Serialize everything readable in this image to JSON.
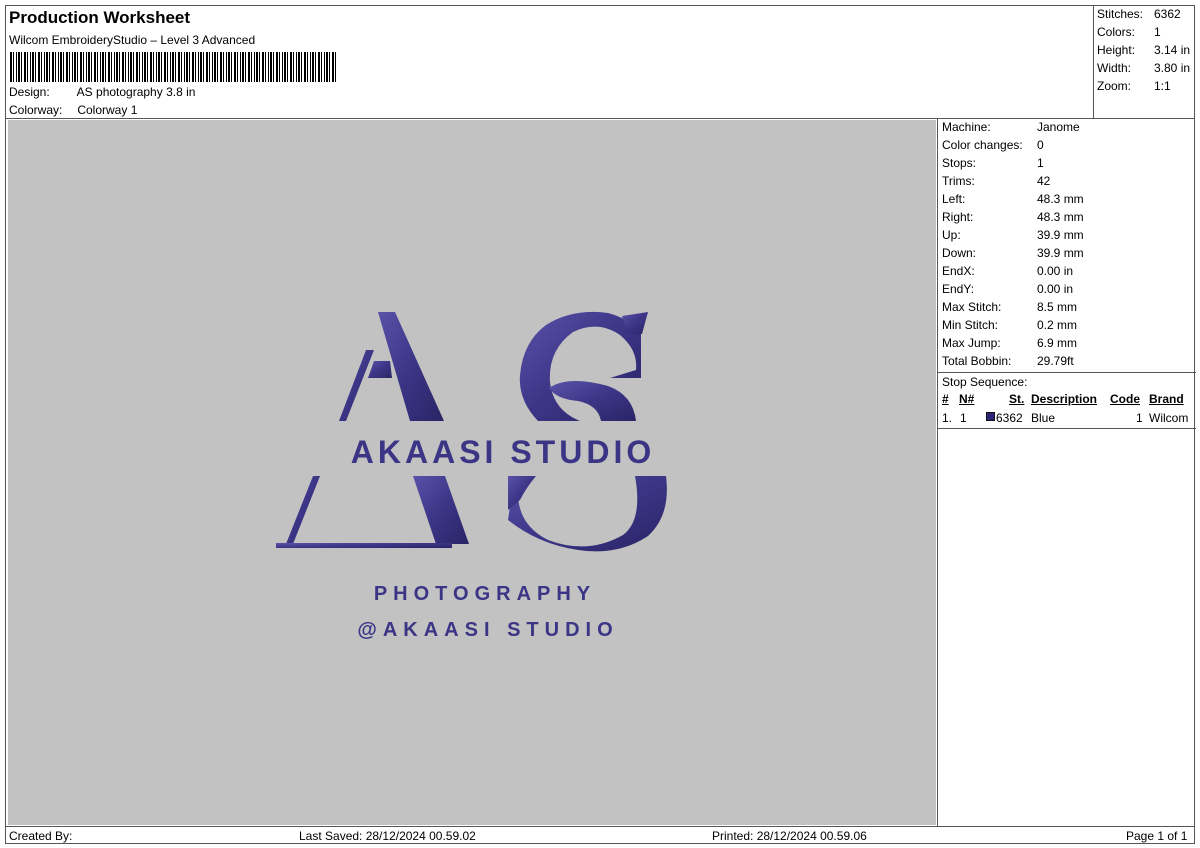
{
  "header": {
    "title": "Production Worksheet",
    "subtitle": "Wilcom EmbroideryStudio – Level 3 Advanced",
    "design_label": "Design:",
    "design_value": "AS photography 3.8 in",
    "colorway_label": "Colorway:",
    "colorway_value": "Colorway 1"
  },
  "summary": {
    "stitches_label": "Stitches:",
    "stitches_value": "6362",
    "colors_label": "Colors:",
    "colors_value": "1",
    "height_label": "Height:",
    "height_value": "3.14 in",
    "width_label": "Width:",
    "width_value": "3.80 in",
    "zoom_label": "Zoom:",
    "zoom_value": "1:1"
  },
  "design": {
    "thread_color": "#3c3586",
    "line1": "AKAASI STUDIO",
    "line2": "PHOTOGRAPHY",
    "line3": "@AKAASI STUDIO"
  },
  "machine": {
    "items": [
      {
        "label": "Machine:",
        "value": "Janome"
      },
      {
        "label": "Color changes:",
        "value": "0"
      },
      {
        "label": "Stops:",
        "value": "1"
      },
      {
        "label": "Trims:",
        "value": "42"
      },
      {
        "label": "Left:",
        "value": "48.3 mm"
      },
      {
        "label": "Right:",
        "value": "48.3 mm"
      },
      {
        "label": "Up:",
        "value": "39.9 mm"
      },
      {
        "label": "Down:",
        "value": "39.9 mm"
      },
      {
        "label": "EndX:",
        "value": "0.00 in"
      },
      {
        "label": "EndY:",
        "value": "0.00 in"
      },
      {
        "label": "Max Stitch:",
        "value": "8.5 mm"
      },
      {
        "label": "Min Stitch:",
        "value": "0.2 mm"
      },
      {
        "label": "Max Jump:",
        "value": "6.9 mm"
      },
      {
        "label": "Total Bobbin:",
        "value": "29.79ft"
      }
    ]
  },
  "stop_sequence": {
    "title": "Stop Sequence:",
    "headers": [
      "#",
      "N#",
      "St.",
      "Description",
      "Code",
      "Brand"
    ],
    "rows": [
      {
        "num": "1.",
        "n": "1",
        "swatch_color": "#2b2475",
        "stitches": "6362",
        "description": "Blue",
        "code": "1",
        "brand": "Wilcom"
      }
    ]
  },
  "footer": {
    "created_by": "Created By:",
    "last_saved": "Last Saved: 28/12/2024 00.59.02",
    "printed": "Printed: 28/12/2024 00.59.06",
    "page": "Page 1 of 1"
  }
}
